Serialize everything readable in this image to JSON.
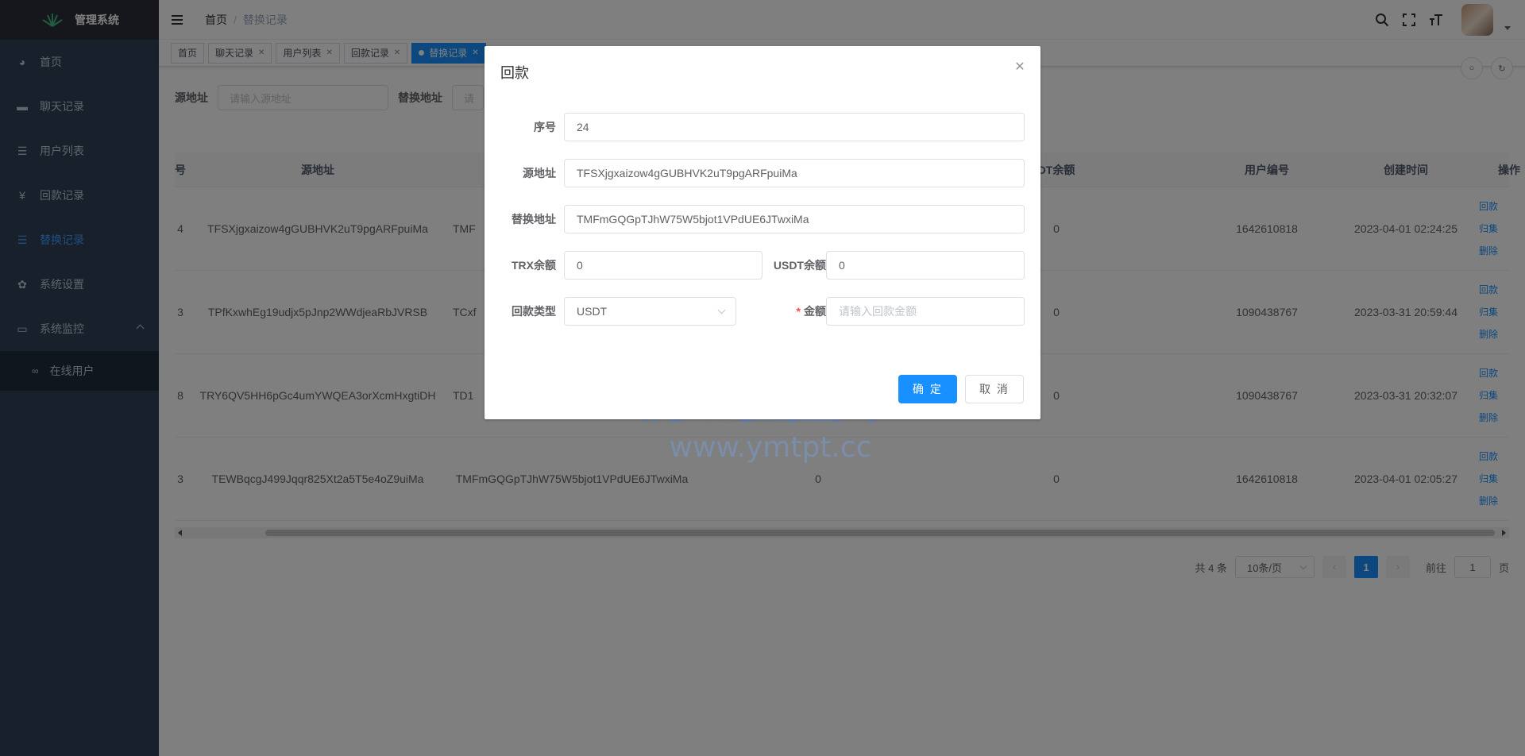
{
  "app": {
    "title": "管理系统"
  },
  "sidebar": {
    "items": [
      {
        "label": "首页",
        "icon": "dashboard-icon"
      },
      {
        "label": "聊天记录",
        "icon": "chat-icon"
      },
      {
        "label": "用户列表",
        "icon": "list-icon"
      },
      {
        "label": "回款记录",
        "icon": "yen-icon"
      },
      {
        "label": "替换记录",
        "icon": "list-icon",
        "active": true
      },
      {
        "label": "系统设置",
        "icon": "gear-icon"
      },
      {
        "label": "系统监控",
        "icon": "monitor-icon",
        "expanded": true
      }
    ],
    "submenu": [
      {
        "label": "在线用户",
        "icon": "online-icon"
      }
    ]
  },
  "navbar": {
    "breadcrumb_home": "首页",
    "breadcrumb_sep": "/",
    "breadcrumb_current": "替换记录"
  },
  "tags": [
    {
      "label": "首页",
      "closable": false
    },
    {
      "label": "聊天记录",
      "closable": true
    },
    {
      "label": "用户列表",
      "closable": true
    },
    {
      "label": "回款记录",
      "closable": true
    },
    {
      "label": "替换记录",
      "closable": true,
      "active": true
    }
  ],
  "search": {
    "source_label": "源地址",
    "source_placeholder": "请输入源地址",
    "replace_label": "替换地址",
    "replace_placeholder": "请"
  },
  "table": {
    "headers": [
      "号",
      "源地址",
      "DT余额",
      "用户编号",
      "创建时间",
      "操作"
    ],
    "rows": [
      {
        "no": "4",
        "source": "TFSXjgxaizow4gGUBHVK2uT9pgARFpuiMa",
        "replace": "TMF",
        "usdt": "0",
        "user_id": "1642610818",
        "created": "2023-04-01 02:24:25"
      },
      {
        "no": "3",
        "source": "TPfKxwhEg19udjx5pJnp2WWdjeaRbJVRSB",
        "replace": "TCxf",
        "usdt": "0",
        "user_id": "1090438767",
        "created": "2023-03-31 20:59:44"
      },
      {
        "no": "8",
        "source": "TRY6QV5HH6pGc4umYWQEA3orXcmHxgtiDH",
        "replace": "TD1",
        "usdt": "0",
        "user_id": "1090438767",
        "created": "2023-03-31 20:32:07"
      },
      {
        "no": "3",
        "source": "TEWBqcgJ499Jqqr825Xt2a5T5e4oZ9uiMa",
        "replace": "TMFmGQGpTJhW75W5bjot1VPdUE6JTwxiMa",
        "trx": "0",
        "usdt": "0",
        "user_id": "1642610818",
        "created": "2023-04-01 02:05:27"
      }
    ],
    "ops": [
      "回款",
      "归集",
      "删除"
    ]
  },
  "pagination": {
    "total": "共 4 条",
    "page_size": "10条/页",
    "current": "1",
    "goto_label": "前往",
    "goto_value": "1",
    "page_suffix": "页"
  },
  "dialog": {
    "title": "回款",
    "fields": {
      "seq_label": "序号",
      "seq_value": "24",
      "source_label": "源地址",
      "source_value": "TFSXjgxaizow4gGUBHVK2uT9pgARFpuiMa",
      "replace_label": "替换地址",
      "replace_value": "TMFmGQGpTJhW75W5bjot1VPdUE6JTwxiMa",
      "trx_label": "TRX余额",
      "trx_value": "0",
      "usdt_label": "USDT余额",
      "usdt_value": "0",
      "type_label": "回款类型",
      "type_value": "USDT",
      "amount_required": "*",
      "amount_label": "金额",
      "amount_placeholder": "请输入回款金额"
    },
    "confirm": "确 定",
    "cancel": "取 消"
  },
  "watermark": {
    "main": "源码平台",
    "url": "www.ymtpt.cc"
  },
  "colors": {
    "primary": "#1890ff",
    "sidebar_bg": "#304156",
    "sidebar_text": "#bfcbd9"
  }
}
